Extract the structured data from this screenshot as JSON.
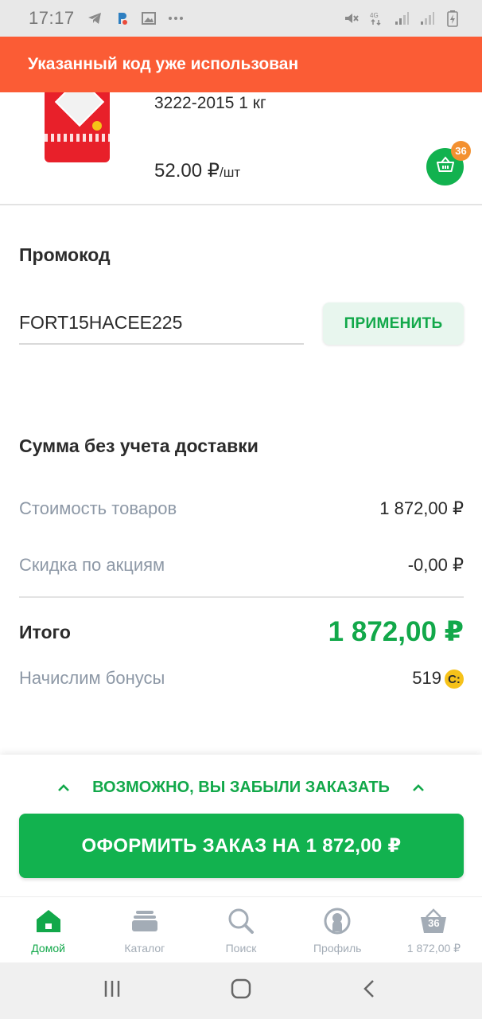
{
  "status_bar": {
    "time": "17:17",
    "icons": [
      "telegram-icon",
      "app-icon",
      "gallery-icon",
      "more-icon",
      "mute-icon",
      "network-4g-icon",
      "signal-icon",
      "signal-icon",
      "battery-icon"
    ]
  },
  "toast": {
    "text": "Указанный код уже использован"
  },
  "product": {
    "title": "3222-2015 1 кг",
    "price": "52.00 ₽",
    "unit": "/шт",
    "cart_count": "36"
  },
  "promo": {
    "title": "Промокод",
    "code": "FORT15HACEE225",
    "apply_label": "ПРИМЕНИТЬ"
  },
  "summary": {
    "title": "Сумма без учета доставки",
    "goods_label": "Стоимость товаров",
    "goods_value": "1 872,00 ₽",
    "discount_label": "Скидка по акциям",
    "discount_value": "-0,00 ₽",
    "total_label": "Итого",
    "total_value": "1 872,00 ₽",
    "bonus_label": "Начислим бонусы",
    "bonus_value": "519",
    "bonus_coin": "С:"
  },
  "bottom": {
    "forgot_label": "ВОЗМОЖНО, ВЫ ЗАБЫЛИ ЗАКАЗАТЬ",
    "checkout_label": "ОФОРМИТЬ ЗАКАЗ НА 1 872,00 ₽"
  },
  "tabs": [
    {
      "label": "Домой",
      "icon": "home-icon",
      "active": true
    },
    {
      "label": "Каталог",
      "icon": "catalog-icon",
      "active": false
    },
    {
      "label": "Поиск",
      "icon": "search-icon",
      "active": false
    },
    {
      "label": "Профиль",
      "icon": "profile-icon",
      "active": false
    },
    {
      "label": "1 872,00 ₽",
      "icon": "basket-icon",
      "active": false,
      "badge": "36"
    }
  ],
  "colors": {
    "accent": "#12b24f",
    "toast": "#fb5c35",
    "badge": "#f39131",
    "label_gray": "#8d98a6"
  }
}
